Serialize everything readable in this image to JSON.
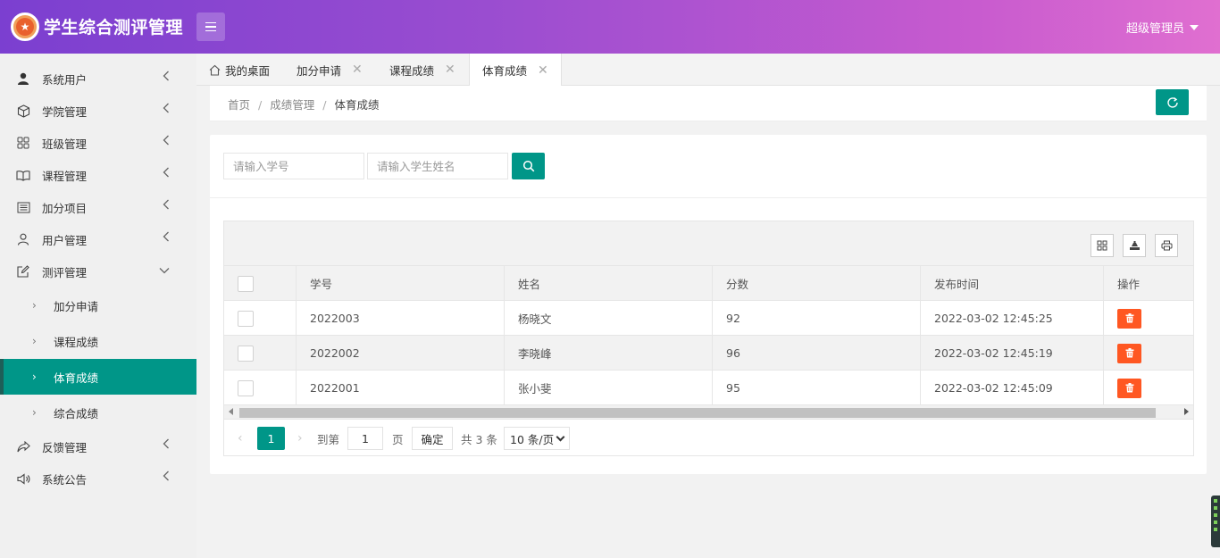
{
  "header": {
    "logo_glyph": "★",
    "app_title": "学生综合测评管理",
    "user_name": "超级管理员"
  },
  "sidebar": {
    "items": [
      {
        "label": "系统用户",
        "icon": "user-filled-icon"
      },
      {
        "label": "学院管理",
        "icon": "cube-icon"
      },
      {
        "label": "班级管理",
        "icon": "grid-icon"
      },
      {
        "label": "课程管理",
        "icon": "book-icon"
      },
      {
        "label": "加分项目",
        "icon": "list-icon"
      },
      {
        "label": "用户管理",
        "icon": "user-icon"
      },
      {
        "label": "测评管理",
        "icon": "edit-icon",
        "expanded": true
      }
    ],
    "sub_items": [
      {
        "label": "加分申请"
      },
      {
        "label": "课程成绩"
      },
      {
        "label": "体育成绩",
        "active": true
      },
      {
        "label": "综合成绩"
      }
    ],
    "items_after": [
      {
        "label": "反馈管理",
        "icon": "share-icon"
      },
      {
        "label": "系统公告",
        "icon": "speaker-icon"
      }
    ]
  },
  "tabs": [
    {
      "label": "我的桌面"
    },
    {
      "label": "加分申请"
    },
    {
      "label": "课程成绩"
    },
    {
      "label": "体育成绩",
      "active": true
    }
  ],
  "breadcrumb": {
    "home": "首页",
    "section": "成绩管理",
    "current": "体育成绩",
    "separator": "/"
  },
  "search": {
    "student_id_placeholder": "请输入学号",
    "student_name_placeholder": "请输入学生姓名"
  },
  "table": {
    "columns": [
      "学号",
      "姓名",
      "分数",
      "发布时间",
      "操作"
    ],
    "rows": [
      {
        "student_id": "2022003",
        "name": "杨晓文",
        "score": "92",
        "published": "2022-03-02 12:45:25"
      },
      {
        "student_id": "2022002",
        "name": "李晓峰",
        "score": "96",
        "published": "2022-03-02 12:45:19"
      },
      {
        "student_id": "2022001",
        "name": "张小斐",
        "score": "95",
        "published": "2022-03-02 12:45:09"
      }
    ]
  },
  "pager": {
    "current_page": "1",
    "goto_label": "到第",
    "goto_value": "1",
    "page_unit": "页",
    "confirm_label": "确定",
    "total_label": "共 3 条",
    "page_size": "10 条/页"
  },
  "colors": {
    "accent": "#009688",
    "danger": "#ff5722",
    "header_start": "#7b3fd0",
    "header_end": "#e06fd0"
  }
}
